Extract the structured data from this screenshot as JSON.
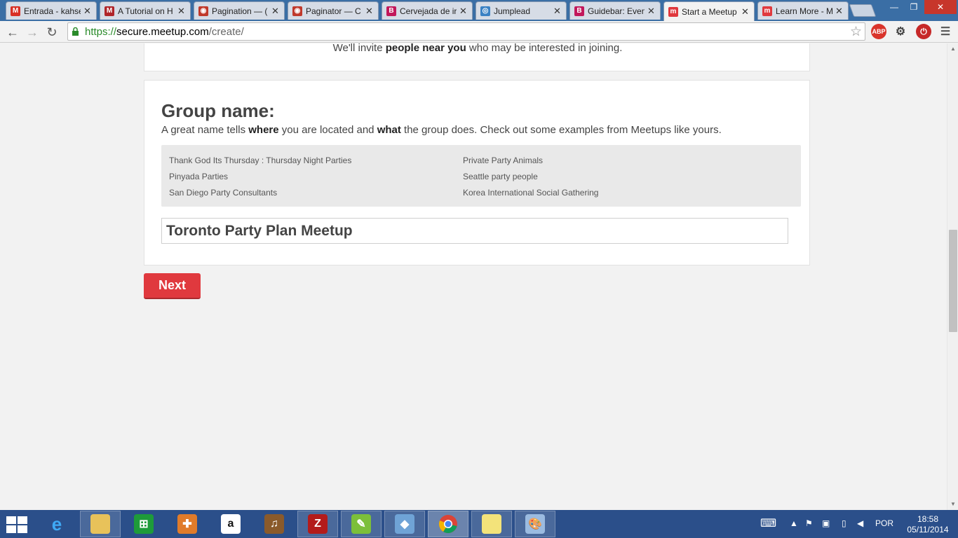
{
  "browser": {
    "tabs": [
      {
        "title": "Entrada - kahse",
        "icon": "gmail-icon",
        "color": "#d93025",
        "glyph": "M"
      },
      {
        "title": "A Tutorial on H",
        "icon": "m-icon",
        "color": "#b0252a",
        "glyph": "M"
      },
      {
        "title": "Pagination — (",
        "icon": "site-icon",
        "color": "#c0392b",
        "glyph": "◉"
      },
      {
        "title": "Paginator — C",
        "icon": "site-icon",
        "color": "#c0392b",
        "glyph": "◉"
      },
      {
        "title": "Cervejada de ir",
        "icon": "b-icon",
        "color": "#c2185b",
        "glyph": "B"
      },
      {
        "title": "Jumplead",
        "icon": "globe-icon",
        "color": "#3b82c4",
        "glyph": "◎"
      },
      {
        "title": "Guidebar: Even",
        "icon": "b-icon",
        "color": "#c2185b",
        "glyph": "B"
      },
      {
        "title": "Start a Meetup",
        "icon": "meetup-icon",
        "color": "#e0393e",
        "glyph": "m"
      },
      {
        "title": "Learn More - M",
        "icon": "meetup-icon",
        "color": "#e0393e",
        "glyph": "m"
      }
    ],
    "active_tab": 7,
    "url": {
      "scheme": "https://",
      "host": "secure.meetup.com",
      "path": "/create/"
    }
  },
  "page": {
    "invite_prefix": "We'll invite ",
    "invite_bold": "people near you",
    "invite_suffix": " who may be interested in joining.",
    "heading": "Group name:",
    "hint_1": "A great name tells ",
    "hint_where": "where",
    "hint_2": " you are located and ",
    "hint_what": "what",
    "hint_3": " the group does. Check out some examples from Meetups like yours.",
    "examples": [
      "Thank God Its Thursday : Thursday Night Parties",
      "Pinyada Parties",
      "San Diego Party Consultants",
      "Private Party Animals",
      "Seattle party people",
      "Korea International Social Gathering"
    ],
    "group_name_value": "Toronto Party Plan Meetup",
    "next_label": "Next"
  },
  "taskbar": {
    "language": "POR",
    "time": "18:58",
    "date": "05/11/2014"
  }
}
